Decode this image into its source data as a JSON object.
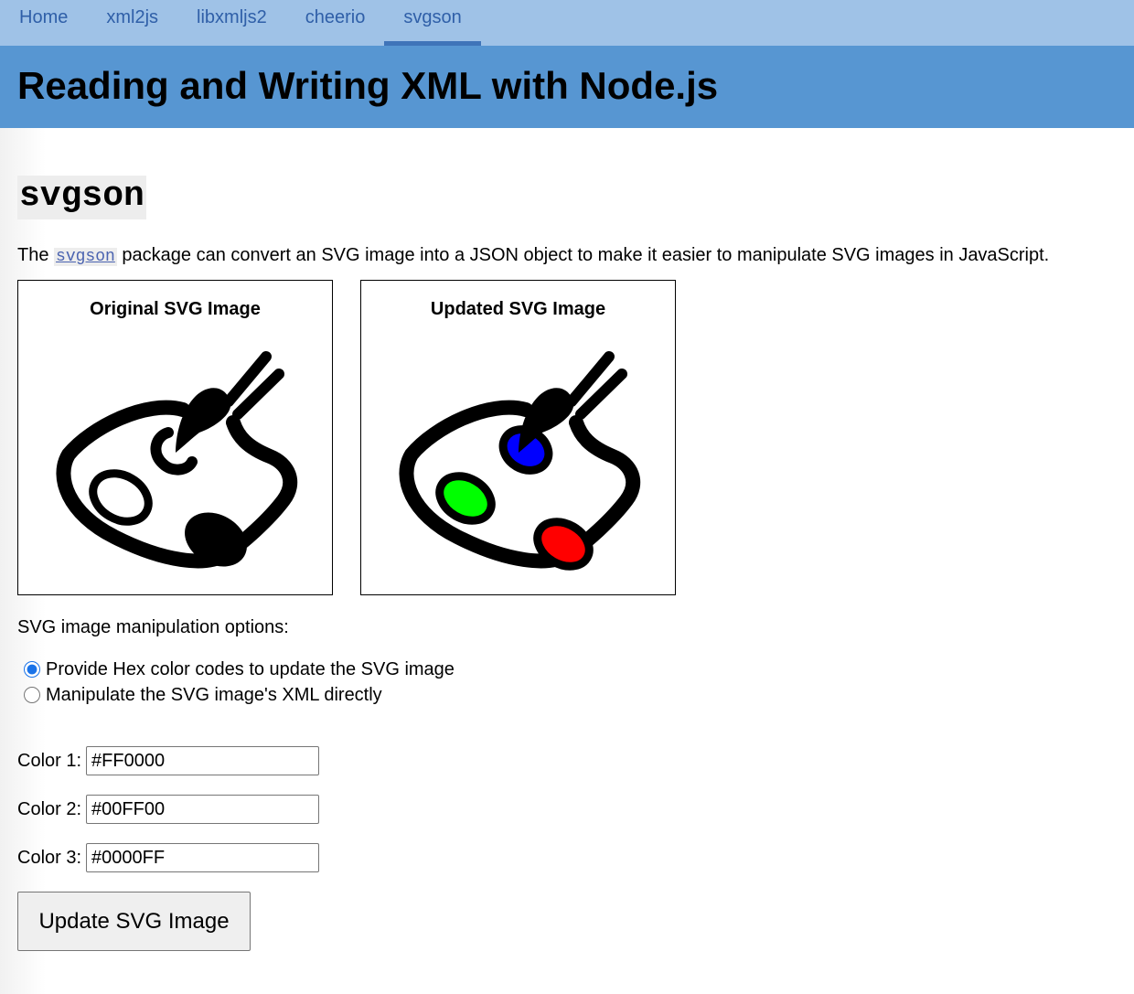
{
  "nav": {
    "items": [
      {
        "label": "Home"
      },
      {
        "label": "xml2js"
      },
      {
        "label": "libxmljs2"
      },
      {
        "label": "cheerio"
      },
      {
        "label": "svgson"
      }
    ],
    "active": "svgson"
  },
  "header": {
    "title": "Reading and Writing XML with Node.js"
  },
  "section": {
    "title": "svgson",
    "intro_before": "The ",
    "intro_link": "svgson",
    "intro_after": " package can convert an SVG image into a JSON object to make it easier to manipulate SVG images in JavaScript."
  },
  "panels": {
    "original": {
      "title": "Original SVG Image",
      "icon": "paint-palette-icon"
    },
    "updated": {
      "title": "Updated SVG Image",
      "icon": "paint-palette-icon"
    }
  },
  "options": {
    "label": "SVG image manipulation options:",
    "radios": [
      {
        "label": "Provide Hex color codes to update the SVG image",
        "checked": true
      },
      {
        "label": "Manipulate the SVG image's XML directly",
        "checked": false
      }
    ]
  },
  "colors": {
    "color1": {
      "label": "Color 1:",
      "value": "#FF0000"
    },
    "color2": {
      "label": "Color 2:",
      "value": "#00FF00"
    },
    "color3": {
      "label": "Color 3:",
      "value": "#0000FF"
    }
  },
  "button": {
    "label": "Update SVG Image"
  },
  "theme": {
    "nav_bg": "#9fc2e7",
    "banner_bg": "#5796d2",
    "link_color": "#2f5fa8"
  }
}
